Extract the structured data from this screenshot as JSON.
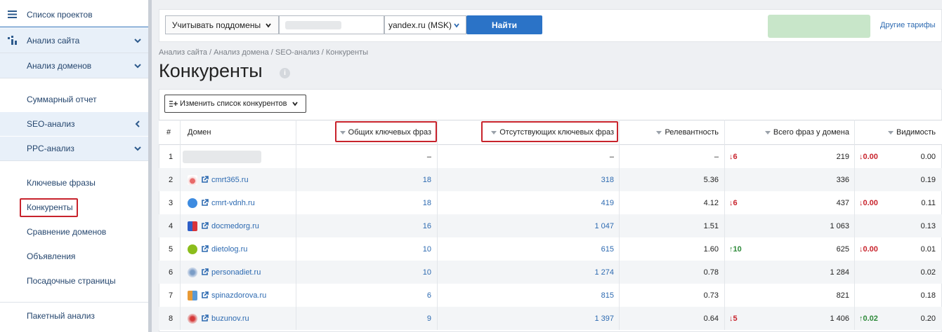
{
  "sidebar": {
    "projects": "Список проектов",
    "site_analysis": "Анализ сайта",
    "domain_analysis": "Анализ доменов",
    "summary": "Суммарный отчет",
    "seo": "SEO-анализ",
    "ppc": "PPC-анализ",
    "keywords": "Ключевые фразы",
    "competitors": "Конкуренты",
    "compare": "Сравнение доменов",
    "ads": "Объявления",
    "landing": "Посадочные страницы",
    "batch": "Пакетный анализ"
  },
  "toolbar": {
    "subdomains": "Учитывать поддомены",
    "search_engine": "yandex.ru (MSK)",
    "find": "Найти",
    "tariffs": "Другие тарифы"
  },
  "breadcrumb": "Анализ сайта / Анализ домена / SEO-анализ / Конкуренты",
  "page_title": "Конкуренты",
  "change_list": "Изменить список конкурентов",
  "table": {
    "headers": {
      "num": "#",
      "domain": "Домен",
      "common": "Общих ключевых фраз",
      "missing": "Отсутствующих ключевых фраз",
      "relevance": "Релевантность",
      "total": "Всего фраз у домена",
      "visibility": "Видимость"
    },
    "rows": [
      {
        "n": "1",
        "domain": "",
        "common": "–",
        "missing": "–",
        "rel": "–",
        "d1": "↓6",
        "d1_dir": "down",
        "total": "219",
        "d2": "↓0.00",
        "d2_dir": "down",
        "vis": "0.00"
      },
      {
        "n": "2",
        "domain": "cmrt365.ru",
        "common": "18",
        "missing": "318",
        "rel": "5.36",
        "d1": "",
        "d1_dir": "",
        "total": "336",
        "d2": "",
        "d2_dir": "",
        "vis": "0.19"
      },
      {
        "n": "3",
        "domain": "cmrt-vdnh.ru",
        "common": "18",
        "missing": "419",
        "rel": "4.12",
        "d1": "↓6",
        "d1_dir": "down",
        "total": "437",
        "d2": "↓0.00",
        "d2_dir": "down",
        "vis": "0.11"
      },
      {
        "n": "4",
        "domain": "docmedorg.ru",
        "common": "16",
        "missing": "1 047",
        "rel": "1.51",
        "d1": "",
        "d1_dir": "",
        "total": "1 063",
        "d2": "",
        "d2_dir": "",
        "vis": "0.13"
      },
      {
        "n": "5",
        "domain": "dietolog.ru",
        "common": "10",
        "missing": "615",
        "rel": "1.60",
        "d1": "↑10",
        "d1_dir": "up",
        "total": "625",
        "d2": "↓0.00",
        "d2_dir": "down",
        "vis": "0.01"
      },
      {
        "n": "6",
        "domain": "personadiet.ru",
        "common": "10",
        "missing": "1 274",
        "rel": "0.78",
        "d1": "",
        "d1_dir": "",
        "total": "1 284",
        "d2": "",
        "d2_dir": "",
        "vis": "0.02"
      },
      {
        "n": "7",
        "domain": "spinazdorova.ru",
        "common": "6",
        "missing": "815",
        "rel": "0.73",
        "d1": "",
        "d1_dir": "",
        "total": "821",
        "d2": "",
        "d2_dir": "",
        "vis": "0.18"
      },
      {
        "n": "8",
        "domain": "buzunov.ru",
        "common": "9",
        "missing": "1 397",
        "rel": "0.64",
        "d1": "↓5",
        "d1_dir": "down",
        "total": "1 406",
        "d2": "↑0.02",
        "d2_dir": "up",
        "vis": "0.20"
      }
    ]
  }
}
